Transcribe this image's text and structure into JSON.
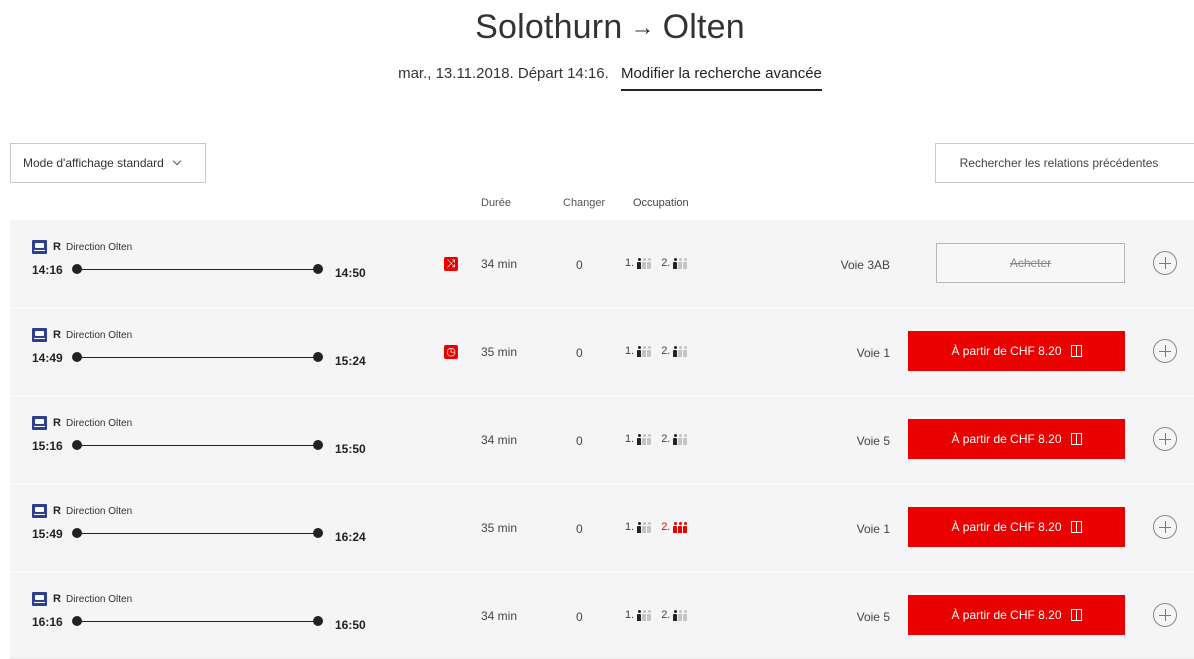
{
  "header": {
    "origin": "Solothurn",
    "arrow": "→",
    "destination": "Olten",
    "search_info": "mar., 13.11.2018. Départ 14:16.",
    "modify_link": "Modifier la recherche avancée"
  },
  "controls": {
    "mode_label": "Mode d'affichage standard",
    "previous_label": "Rechercher les relations précédentes"
  },
  "columns": {
    "duration": "Durée",
    "changes": "Changer",
    "occupation": "Occupation"
  },
  "connections": [
    {
      "category": "R",
      "direction": "Direction Olten",
      "departure": "14:16",
      "arrival": "14:50",
      "notice_icon": "route-change-icon",
      "notice_glyph": "⤨",
      "duration": "34 min",
      "changes": "0",
      "occupancy": {
        "first_class": "1.",
        "first_level": 1,
        "second_class": "2.",
        "second_level": 1
      },
      "platform": "Voie 3AB",
      "buy_label": "Acheter",
      "buy_enabled": false
    },
    {
      "category": "R",
      "direction": "Direction Olten",
      "departure": "14:49",
      "arrival": "15:24",
      "notice_icon": "clock-icon",
      "notice_glyph": "◷",
      "duration": "35 min",
      "changes": "0",
      "occupancy": {
        "first_class": "1.",
        "first_level": 1,
        "second_class": "2.",
        "second_level": 1
      },
      "platform": "Voie 1",
      "buy_label": "À partir de CHF 8.20",
      "buy_enabled": true
    },
    {
      "category": "R",
      "direction": "Direction Olten",
      "departure": "15:16",
      "arrival": "15:50",
      "duration": "34 min",
      "changes": "0",
      "occupancy": {
        "first_class": "1.",
        "first_level": 1,
        "second_class": "2.",
        "second_level": 1
      },
      "platform": "Voie 5",
      "buy_label": "À partir de CHF 8.20",
      "buy_enabled": true
    },
    {
      "category": "R",
      "direction": "Direction Olten",
      "departure": "15:49",
      "arrival": "16:24",
      "duration": "35 min",
      "changes": "0",
      "occupancy": {
        "first_class": "1.",
        "first_level": 1,
        "second_class": "2.",
        "second_level": 3
      },
      "platform": "Voie 1",
      "buy_label": "À partir de CHF 8.20",
      "buy_enabled": true
    },
    {
      "category": "R",
      "direction": "Direction Olten",
      "departure": "16:16",
      "arrival": "16:50",
      "duration": "34 min",
      "changes": "0",
      "occupancy": {
        "first_class": "1.",
        "first_level": 1,
        "second_class": "2.",
        "second_level": 1
      },
      "platform": "Voie 5",
      "buy_label": "À partir de CHF 8.20",
      "buy_enabled": true
    }
  ],
  "colors": {
    "accent_red": "#eb0000",
    "train_icon_blue": "#2e3f8f",
    "row_background": "#f5f5f5"
  }
}
